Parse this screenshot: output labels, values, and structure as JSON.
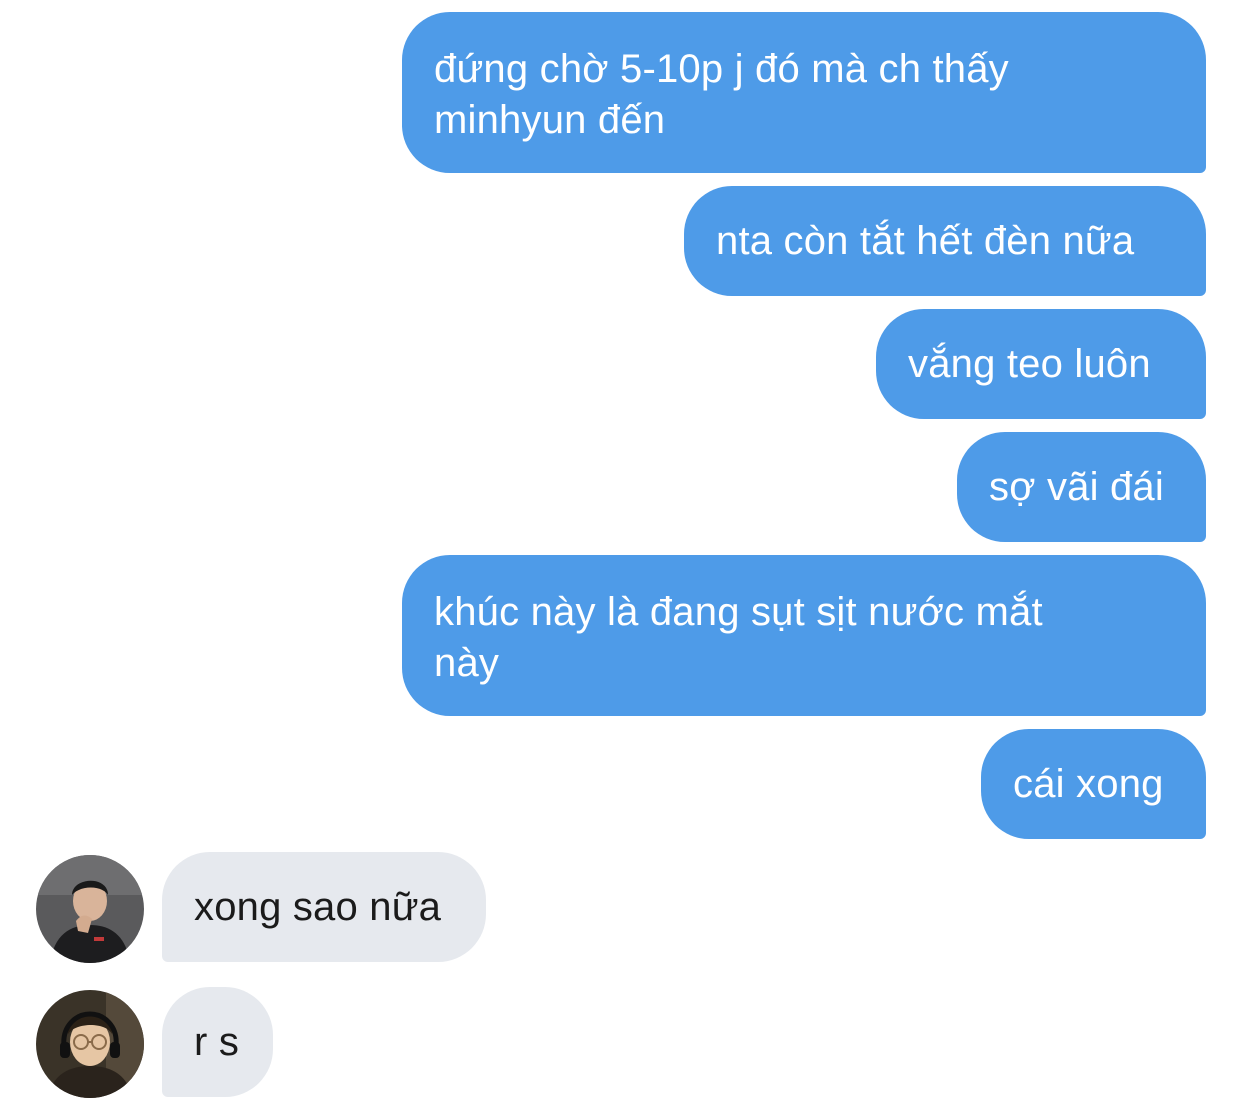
{
  "conversation": {
    "messages": [
      {
        "direction": "outgoing",
        "text": "đứng chờ 5-10p j đó mà ch thấy minhyun đến"
      },
      {
        "direction": "outgoing",
        "text": "nta còn tắt hết đèn nữa"
      },
      {
        "direction": "outgoing",
        "text": "vắng teo luôn"
      },
      {
        "direction": "outgoing",
        "text": "sợ vãi đái"
      },
      {
        "direction": "outgoing",
        "text": "khúc này là đang sụt sịt nước mắt này"
      },
      {
        "direction": "outgoing",
        "text": "cái xong"
      },
      {
        "direction": "incoming",
        "text": "xong sao nữa",
        "avatar": "profile-photo-person-dark-jacket"
      },
      {
        "direction": "incoming",
        "text": "r s",
        "avatar": "profile-photo-person-glasses-headphones"
      }
    ]
  },
  "colors": {
    "outgoing_bubble": "#4e9be8",
    "outgoing_text": "#ffffff",
    "incoming_bubble": "#e6e9ee",
    "incoming_text": "#1b1b1b",
    "background": "#ffffff"
  }
}
